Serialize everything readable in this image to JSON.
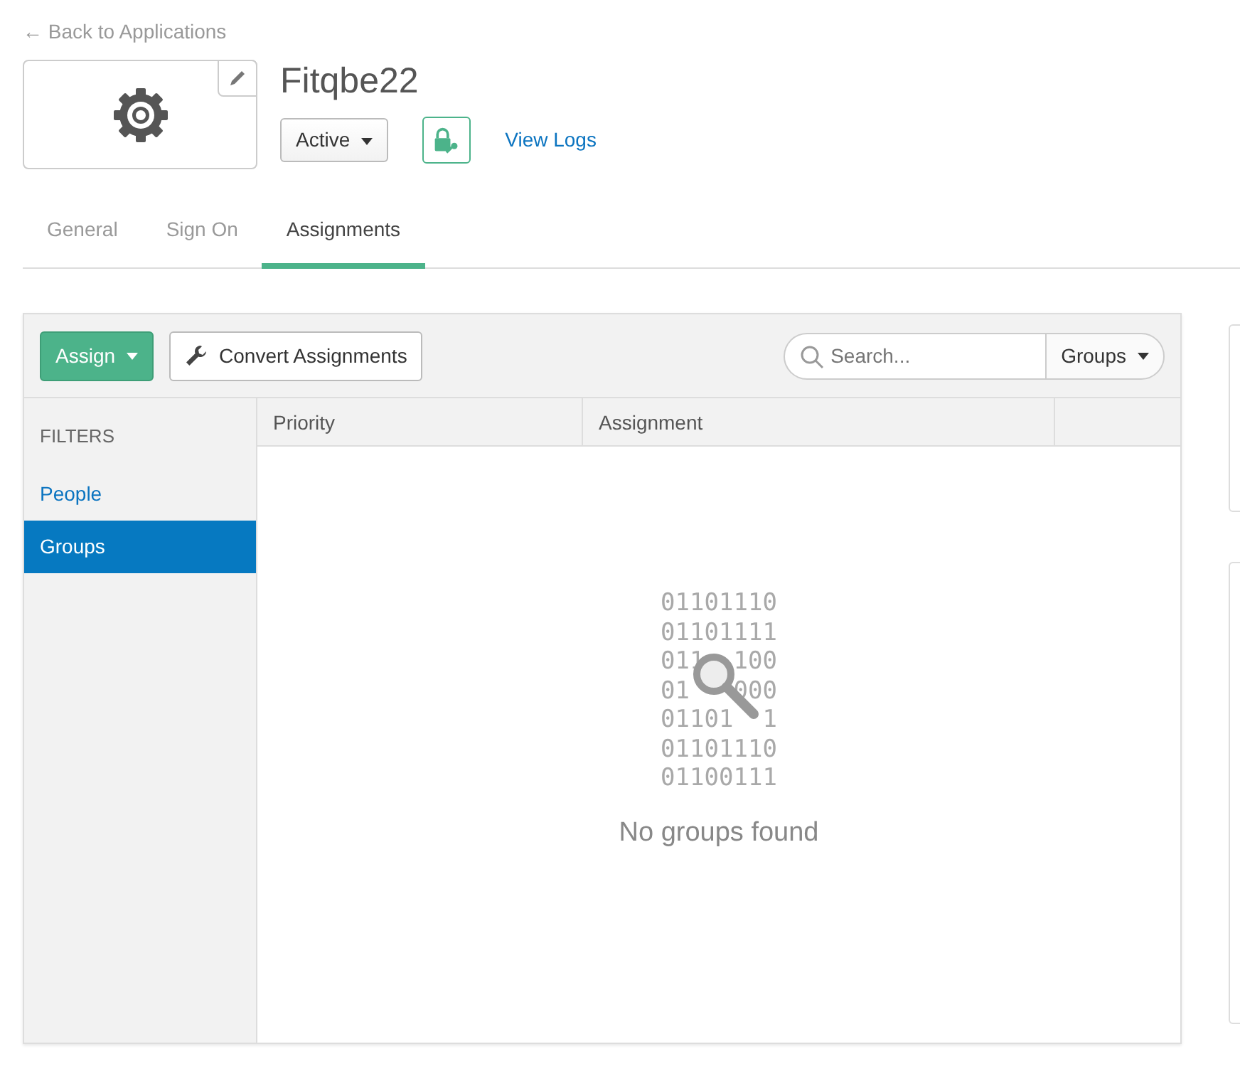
{
  "back_link": {
    "arrow": "←",
    "label": "Back to Applications"
  },
  "app": {
    "title": "Fitqbe22",
    "status": "Active",
    "view_logs": "View Logs"
  },
  "tabs": [
    {
      "label": "General",
      "selected": false
    },
    {
      "label": "Sign On",
      "selected": false
    },
    {
      "label": "Assignments",
      "selected": true
    }
  ],
  "toolbar": {
    "assign": "Assign",
    "convert": "Convert Assignments",
    "search": {
      "placeholder": "Search..."
    },
    "filter_type": "Groups"
  },
  "filters": {
    "heading": "FILTERS",
    "items": [
      {
        "label": "People",
        "selected": false
      },
      {
        "label": "Groups",
        "selected": true
      }
    ]
  },
  "table": {
    "columns": [
      "Priority",
      "Assignment"
    ]
  },
  "empty_state": {
    "binary": [
      "01101110",
      "01101111",
      "011  100",
      "01   000",
      "01101  1",
      "01101110",
      "01100111"
    ],
    "message": "No groups found"
  }
}
